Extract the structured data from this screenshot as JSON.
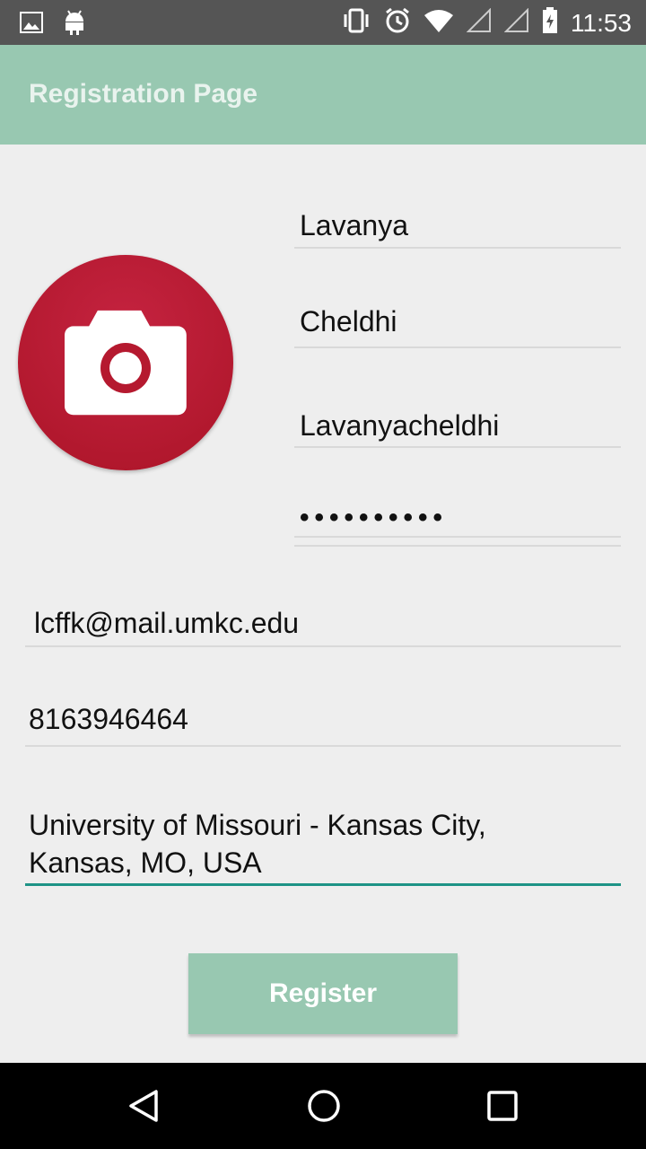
{
  "status_bar": {
    "time": "11:53",
    "icons": [
      "image-icon",
      "android-icon",
      "vibrate-icon",
      "alarm-icon",
      "wifi-icon",
      "signal-icon",
      "signal-icon",
      "battery-icon"
    ]
  },
  "app_bar": {
    "title": "Registration Page"
  },
  "form": {
    "first_name": "Lavanya",
    "last_name": "Cheldhi",
    "username": "Lavanyacheldhi",
    "password": "••••••••••",
    "email": "lcffk@mail.umkc.edu",
    "phone": "8163946464",
    "address_line1": "University of Missouri - Kansas City,",
    "address_line2": "Kansas, MO, USA"
  },
  "register_label": "Register",
  "colors": {
    "app_bar": "#98c8b1",
    "avatar": "#b0172c",
    "focus_underline": "#1e9386"
  },
  "nav_bar": {
    "icons": [
      "back-icon",
      "home-icon",
      "recents-icon"
    ]
  }
}
